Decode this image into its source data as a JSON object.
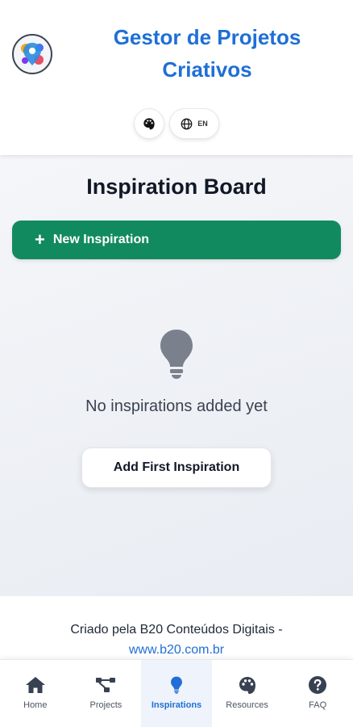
{
  "header": {
    "app_title": "Gestor de Projetos Criativos",
    "theme_icon": "palette-icon",
    "language": {
      "icon": "globe-icon",
      "code": "EN"
    }
  },
  "main": {
    "title": "Inspiration Board",
    "new_button": {
      "icon": "plus-icon",
      "label": "New Inspiration"
    },
    "empty_state": {
      "icon": "lightbulb-icon",
      "message": "No inspirations added yet",
      "button_label": "Add First Inspiration"
    }
  },
  "footer": {
    "credit": "Criado pela B20 Conteúdos Digitais -",
    "link": "www.b20.com.br"
  },
  "nav": {
    "items": [
      {
        "label": "Home",
        "icon": "home-icon"
      },
      {
        "label": "Projects",
        "icon": "project-tree-icon"
      },
      {
        "label": "Inspirations",
        "icon": "lightbulb-icon",
        "active": true
      },
      {
        "label": "Resources",
        "icon": "palette-icon"
      },
      {
        "label": "FAQ",
        "icon": "question-icon"
      }
    ]
  },
  "colors": {
    "brand_blue": "#1f6fd6",
    "primary_green": "#128a5f",
    "icon_gray": "#6b7280",
    "nav_icon": "#374151"
  }
}
